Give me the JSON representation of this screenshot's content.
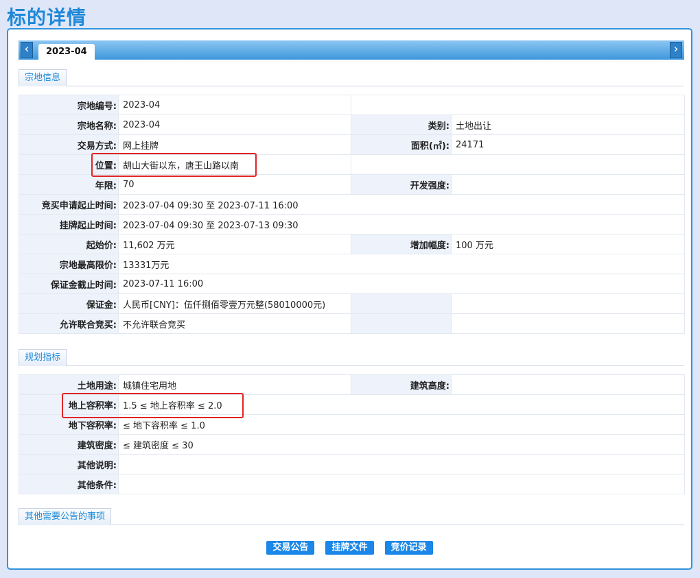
{
  "page": {
    "title": "标的详情"
  },
  "tabs": [
    {
      "label": "2023-04",
      "active": true
    }
  ],
  "icons": {
    "prev": "chevron-left-icon",
    "next": "chevron-right-icon"
  },
  "sections": {
    "land_info": "宗地信息",
    "planning": "规划指标",
    "other": "其他需要公告的事项"
  },
  "land_info": {
    "parcel_no_label": "宗地编号:",
    "parcel_no": "2023-04",
    "parcel_name_label": "宗地名称:",
    "parcel_name": "2023-04",
    "category_label": "类别:",
    "category": "土地出让",
    "trade_mode_label": "交易方式:",
    "trade_mode": "网上挂牌",
    "area_label": "面积(㎡):",
    "area": "24171",
    "location_label": "位置:",
    "location": "胡山大街以东，唐王山路以南",
    "years_label": "年限:",
    "years": "70",
    "dev_intensity_label": "开发强度:",
    "dev_intensity": "",
    "apply_period_label": "竞买申请起止时间:",
    "apply_period": "2023-07-04 09:30 至 2023-07-11 16:00",
    "listing_period_label": "挂牌起止时间:",
    "listing_period": "2023-07-04 09:30 至 2023-07-13 09:30",
    "start_price_label": "起始价:",
    "start_price": "11,602 万元",
    "increment_label": "增加幅度:",
    "increment": "100 万元",
    "max_price_label": "宗地最高限价:",
    "max_price": "13331万元",
    "deposit_deadline_label": "保证金截止时间:",
    "deposit_deadline": "2023-07-11 16:00",
    "deposit_label": "保证金:",
    "deposit": "人民币[CNY]：伍仟捌佰零壹万元整(58010000元)",
    "joint_bid_label": "允许联合竞买:",
    "joint_bid": "不允许联合竞买"
  },
  "planning": {
    "land_use_label": "土地用途:",
    "land_use": "城镇住宅用地",
    "building_height_label": "建筑高度:",
    "building_height": "",
    "far_above_label": "地上容积率:",
    "far_above": "1.5 ≤ 地上容积率 ≤ 2.0",
    "far_below_label": "地下容积率:",
    "far_below": "≤ 地下容积率 ≤ 1.0",
    "density_label": "建筑密度:",
    "density": "≤ 建筑密度 ≤ 30",
    "other_notes_label": "其他说明:",
    "other_notes": "",
    "other_conditions_label": "其他条件:",
    "other_conditions": ""
  },
  "buttons": {
    "announcement": "交易公告",
    "listing_docs": "挂牌文件",
    "bid_records": "竞价记录"
  },
  "colors": {
    "accent": "#1e88d8",
    "button": "#1b87e8",
    "highlight": "#e12424",
    "label_bg": "#edf2fb"
  }
}
